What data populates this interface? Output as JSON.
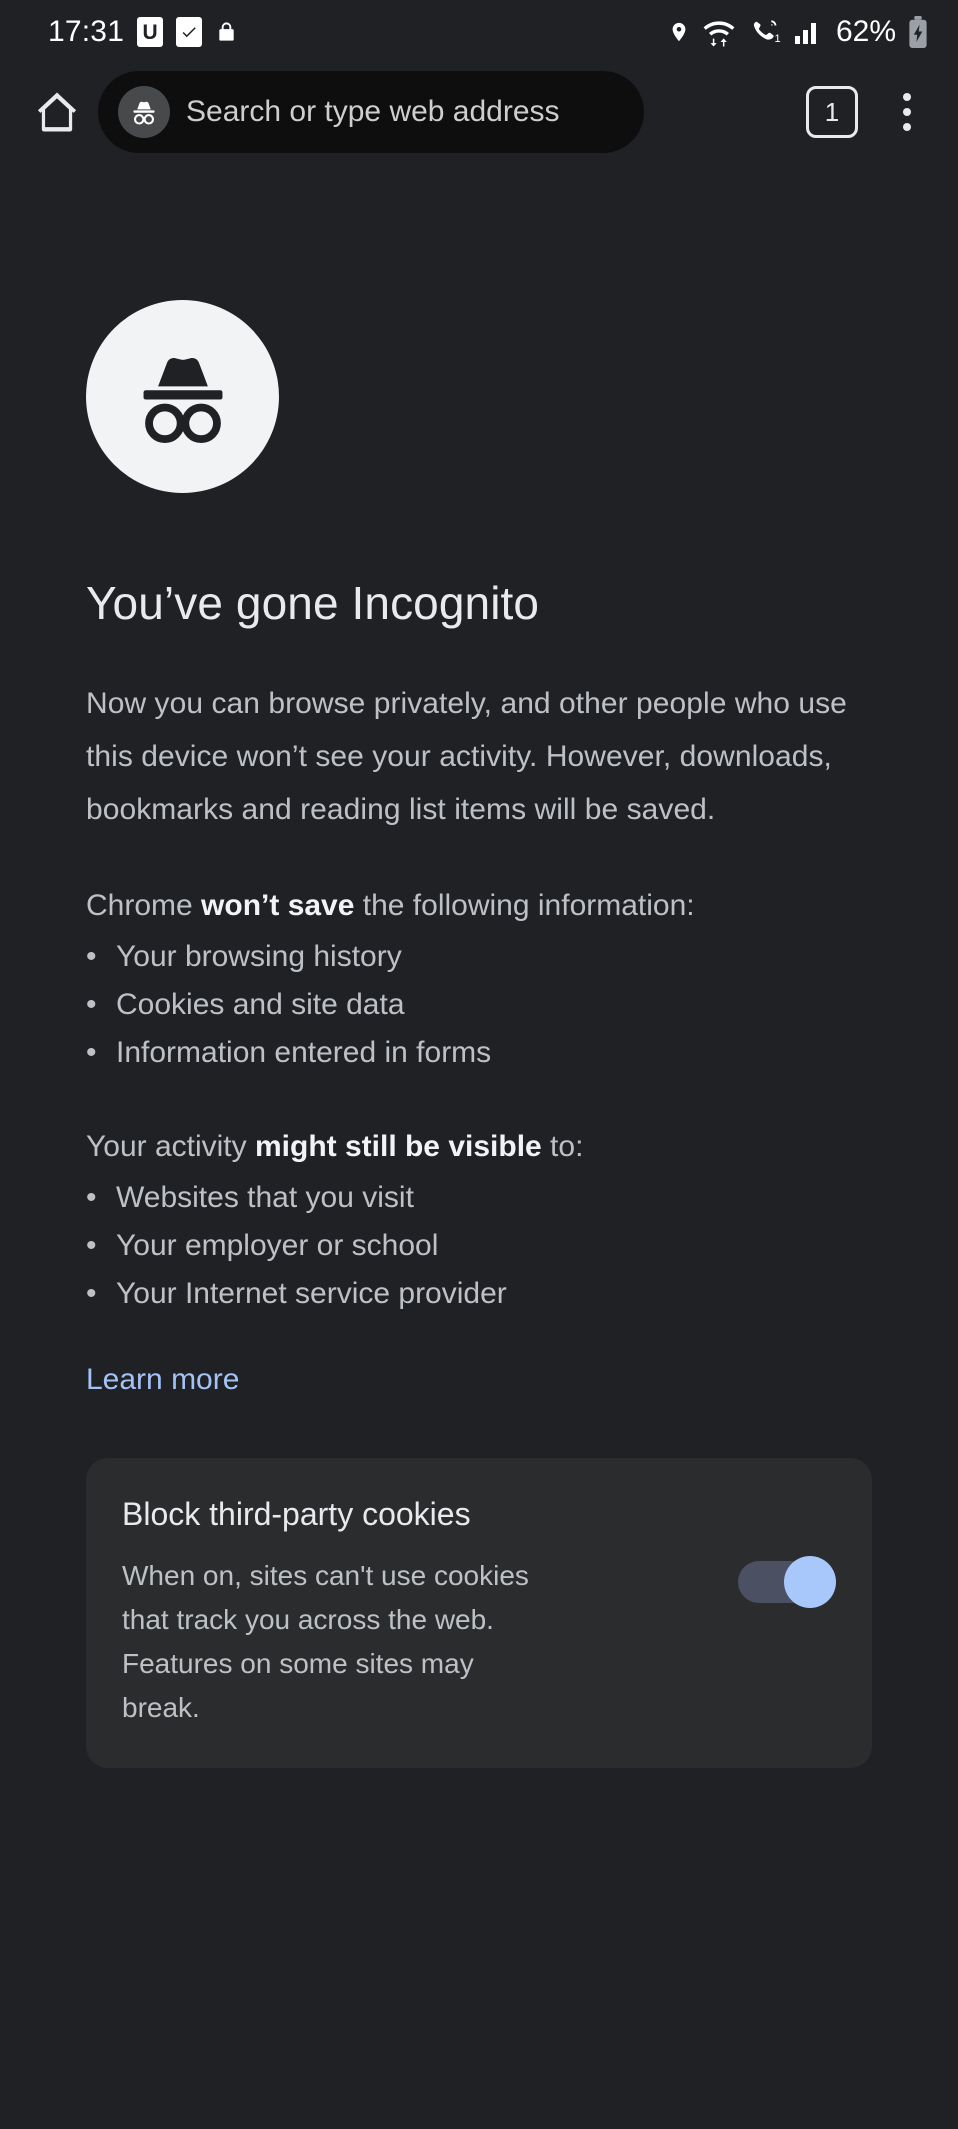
{
  "status_bar": {
    "clock": "17:31",
    "badge_u_label": "U",
    "badge_check_label": "✔",
    "lock_icon": "lock-icon",
    "location_icon": "location-pin-icon",
    "wifi_icon": "wifi-data-transfer-icon",
    "call_icon": "call-sim1-icon",
    "signal_icon": "cellular-signal-icon",
    "battery_percent": "62%",
    "battery_icon": "battery-charging-icon"
  },
  "toolbar": {
    "home_icon": "home-icon",
    "omnibox_badge_icon": "incognito-icon",
    "omnibox_text": "Search or type web address",
    "omnibox_placeholder": "Search or type web address",
    "tab_count": "1",
    "menu_icon": "more-vertical-icon"
  },
  "page": {
    "avatar_icon": "incognito-icon",
    "title": "You’ve gone Incognito",
    "intro": "Now you can browse privately, and other people who use this device won’t see your activity. However, downloads, bookmarks and reading list items will be saved.",
    "wont_save": {
      "heading_prefix": "Chrome ",
      "heading_bold": "won’t save",
      "heading_suffix": " the following information:",
      "items": [
        "Your browsing history",
        "Cookies and site data",
        "Information entered in forms"
      ]
    },
    "might_see": {
      "heading_prefix": "Your activity ",
      "heading_bold": "might still be visible",
      "heading_suffix": " to:",
      "items": [
        "Websites that you visit",
        "Your employer or school",
        "Your Internet service provider"
      ]
    },
    "learn_more_label": "Learn more",
    "bullet_glyph": "•"
  },
  "cookie_card": {
    "title": "Block third-party cookies",
    "description": "When on, sites can't use cookies that track you across the web. Features on some sites may break.",
    "toggle_state": "on"
  },
  "colors": {
    "background": "#202124",
    "card_background": "#2b2c2e",
    "omnibox_background": "#0e0e0f",
    "primary_text": "#e8eaed",
    "secondary_text": "#bdc1c6",
    "link": "#a3c2f5",
    "toggle_thumb_on": "#a8c7fa",
    "toggle_track_on": "#4b5162",
    "avatar_background": "#f1f3f4"
  }
}
